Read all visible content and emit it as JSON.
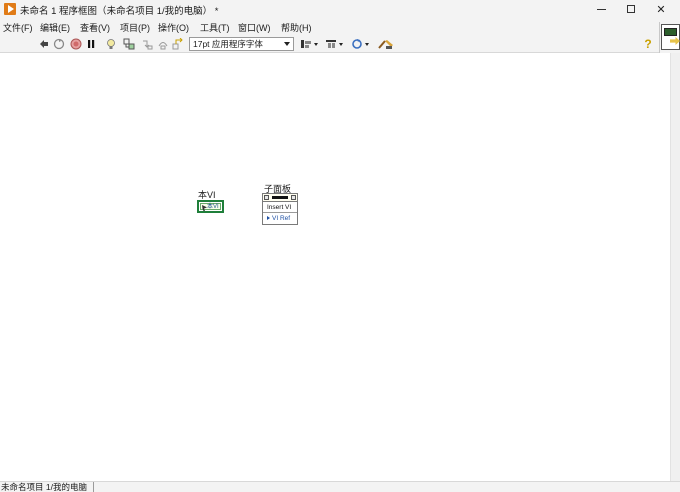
{
  "window": {
    "title": "未命名 1 程序框图（未命名项目 1/我的电脑）  *",
    "controls": {
      "minimize": "minimize",
      "maximize": "maximize",
      "close": "✕"
    }
  },
  "menu": {
    "items": [
      "文件(F)",
      "编辑(E)",
      "查看(V)",
      "项目(P)",
      "操作(O)",
      "工具(T)",
      "窗口(W)",
      "帮助(H)"
    ]
  },
  "toolbar": {
    "icons": [
      "run-continuously-icon",
      "run-icon",
      "abort-icon",
      "pause-icon",
      "highlight-execution-icon",
      "retain-wire-values-icon",
      "step-into-icon",
      "step-over-icon",
      "step-out-icon"
    ],
    "font_select_value": "17pt 应用程序字体",
    "align_icons": [
      "align-objects-icon",
      "distribute-objects-icon",
      "reorder-icon",
      "cleanup-diagram-icon"
    ],
    "help_glyph": "?"
  },
  "diagram": {
    "this_vi": {
      "label": "本VI",
      "text": "本VI"
    },
    "subpanel": {
      "label": "子面板",
      "rows": [
        "Insert VI",
        "VI Ref"
      ]
    }
  },
  "status": {
    "text": "未命名项目 1/我的电脑"
  },
  "colors": {
    "chrome": "#f3f3f3",
    "node_border_green": "#1f7f3a",
    "ref_blue": "#1d4fa3",
    "app_icon_orange": "#e07b17"
  }
}
